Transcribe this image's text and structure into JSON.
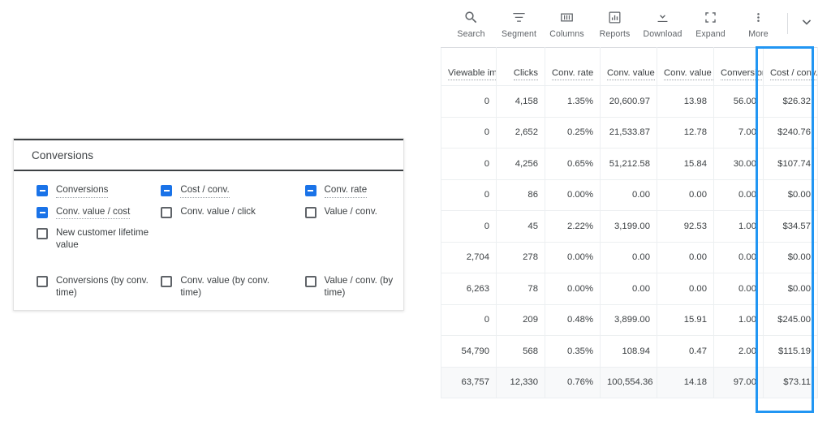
{
  "panel": {
    "title": "Conversions",
    "rows": [
      [
        {
          "label": "Conversions",
          "state": "on",
          "dotted": true
        },
        {
          "label": "Cost / conv.",
          "state": "on",
          "dotted": true
        },
        {
          "label": "Conv. rate",
          "state": "on",
          "dotted": true
        }
      ],
      [
        {
          "label": "Conv. value / cost",
          "state": "on",
          "dotted": true
        },
        {
          "label": "Conv. value / click",
          "state": "off",
          "dotted": false
        },
        {
          "label": "Value / conv.",
          "state": "off",
          "dotted": false
        }
      ],
      [
        {
          "label": "New customer lifetime value",
          "state": "off",
          "dotted": false
        },
        {
          "label": "",
          "state": "none",
          "dotted": false
        },
        {
          "label": "",
          "state": "none",
          "dotted": false
        }
      ],
      [
        {
          "label": "Conversions (by conv. time)",
          "state": "off",
          "dotted": false
        },
        {
          "label": "Conv. value (by conv. time)",
          "state": "off",
          "dotted": false
        },
        {
          "label": "Value / conv. (by time)",
          "state": "off",
          "dotted": false
        }
      ]
    ]
  },
  "toolbar": {
    "items": [
      {
        "label": "Search",
        "icon": "search-icon"
      },
      {
        "label": "Segment",
        "icon": "segment-icon"
      },
      {
        "label": "Columns",
        "icon": "columns-icon"
      },
      {
        "label": "Reports",
        "icon": "reports-icon"
      },
      {
        "label": "Download",
        "icon": "download-icon"
      },
      {
        "label": "Expand",
        "icon": "expand-icon"
      },
      {
        "label": "More",
        "icon": "more-vert-icon"
      }
    ],
    "chevron": "chevron-down-icon"
  },
  "highlight_color": "#2196f3",
  "link_color": "#1a73e8",
  "chart_data": {
    "type": "table",
    "title": "",
    "columns": [
      "Viewable impr.",
      "Clicks",
      "Conv. rate",
      "Conv. value",
      "Conv. value / cost",
      "Conversions",
      "Cost / conv."
    ],
    "highlighted_column": "Cost / conv.",
    "rows": [
      {
        "cells": [
          "0",
          "4,158",
          "1.35%",
          "20,600.97",
          "13.98",
          "56.00",
          "$26.32"
        ],
        "links": [
          3
        ],
        "total": false
      },
      {
        "cells": [
          "0",
          "2,652",
          "0.25%",
          "21,533.87",
          "12.78",
          "7.00",
          "$240.76"
        ],
        "links": [],
        "total": false
      },
      {
        "cells": [
          "0",
          "4,256",
          "0.65%",
          "51,212.58",
          "15.84",
          "30.00",
          "$107.74"
        ],
        "links": [],
        "total": false
      },
      {
        "cells": [
          "0",
          "86",
          "0.00%",
          "0.00",
          "0.00",
          "0.00",
          "$0.00"
        ],
        "links": [
          1
        ],
        "total": false
      },
      {
        "cells": [
          "0",
          "45",
          "2.22%",
          "3,199.00",
          "92.53",
          "1.00",
          "$34.57"
        ],
        "links": [],
        "total": false
      },
      {
        "cells": [
          "2,704",
          "278",
          "0.00%",
          "0.00",
          "0.00",
          "0.00",
          "$0.00"
        ],
        "links": [],
        "total": false
      },
      {
        "cells": [
          "6,263",
          "78",
          "0.00%",
          "0.00",
          "0.00",
          "0.00",
          "$0.00"
        ],
        "links": [],
        "total": false
      },
      {
        "cells": [
          "0",
          "209",
          "0.48%",
          "3,899.00",
          "15.91",
          "1.00",
          "$245.00"
        ],
        "links": [],
        "total": false
      },
      {
        "cells": [
          "54,790",
          "568",
          "0.35%",
          "108.94",
          "0.47",
          "2.00",
          "$115.19"
        ],
        "links": [],
        "total": false
      },
      {
        "cells": [
          "63,757",
          "12,330",
          "0.76%",
          "100,554.36",
          "14.18",
          "97.00",
          "$73.11"
        ],
        "links": [],
        "total": true
      }
    ]
  }
}
